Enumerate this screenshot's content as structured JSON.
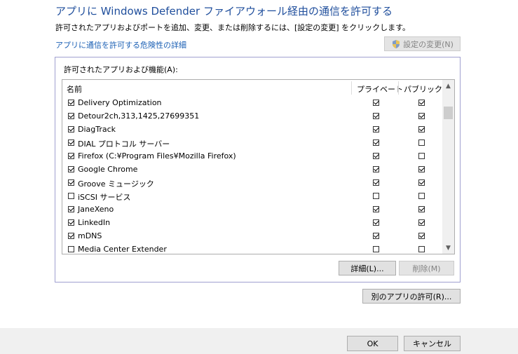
{
  "title": "アプリに Windows Defender ファイアウォール経由の通信を許可する",
  "description": "許可されたアプリおよびポートを追加、変更、または削除するには、[設定の変更] をクリックします。",
  "risk_link": "アプリに通信を許可する危険性の詳細",
  "change_settings_button": "設定の変更(N)",
  "panel_label": "許可されたアプリおよび機能(A):",
  "columns": {
    "name": "名前",
    "private": "プライベート",
    "public": "パブリック"
  },
  "apps": [
    {
      "name": "Delivery Optimization",
      "enabled": true,
      "private": true,
      "public": true
    },
    {
      "name": "Detour2ch,313,1425,27699351",
      "enabled": true,
      "private": true,
      "public": true
    },
    {
      "name": "DiagTrack",
      "enabled": true,
      "private": true,
      "public": true
    },
    {
      "name": "DIAL プロトコル サーバー",
      "enabled": true,
      "private": true,
      "public": false
    },
    {
      "name": "Firefox (C:¥Program Files¥Mozilla Firefox)",
      "enabled": true,
      "private": true,
      "public": false
    },
    {
      "name": "Google Chrome",
      "enabled": true,
      "private": true,
      "public": true
    },
    {
      "name": "Groove ミュージック",
      "enabled": true,
      "private": true,
      "public": true
    },
    {
      "name": "iSCSI サービス",
      "enabled": false,
      "private": false,
      "public": false
    },
    {
      "name": "JaneXeno",
      "enabled": true,
      "private": true,
      "public": true
    },
    {
      "name": "LinkedIn",
      "enabled": true,
      "private": true,
      "public": true
    },
    {
      "name": "mDNS",
      "enabled": true,
      "private": true,
      "public": true
    },
    {
      "name": "Media Center Extender",
      "enabled": false,
      "private": false,
      "public": false
    }
  ],
  "details_button": "詳細(L)...",
  "remove_button": "削除(M)",
  "allow_another_button": "別のアプリの許可(R)...",
  "ok_button": "OK",
  "cancel_button": "キャンセル"
}
